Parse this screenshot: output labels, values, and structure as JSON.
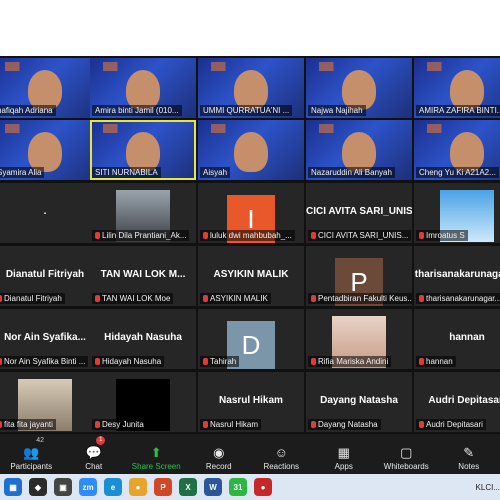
{
  "tiles": [
    {
      "name": "hafiqah-adriana",
      "label": "hafiqah Adriana",
      "kind": "video",
      "muted": false
    },
    {
      "name": "amira-binti-jamil",
      "label": "Amira binti Jamil (010...",
      "kind": "video",
      "muted": false
    },
    {
      "name": "ummi-qurratua",
      "label": "UMMI QURRATUA'NI ...",
      "kind": "video",
      "muted": false
    },
    {
      "name": "najwa-najihah",
      "label": "Najwa Najihah",
      "kind": "video",
      "muted": false
    },
    {
      "name": "amira-zafira",
      "label": "AMIRA ZAFIRA BINTI...",
      "kind": "video",
      "muted": false
    },
    {
      "name": "syamira-alia",
      "label": "Syamira Alia",
      "kind": "video",
      "muted": false
    },
    {
      "name": "siti-nurnabila",
      "label": "SITI NURNABILA",
      "kind": "video",
      "muted": false,
      "active": true
    },
    {
      "name": "aisyah",
      "label": "Aisyah",
      "kind": "video",
      "muted": false
    },
    {
      "name": "nazaruddin",
      "label": "Nazaruddin Ali Banyah",
      "kind": "video",
      "muted": false
    },
    {
      "name": "cheng-yu-ki",
      "label": "Cheng Yu Ki A21A2...",
      "kind": "video",
      "muted": false
    },
    {
      "name": "dot-user",
      "label": "",
      "center": ".",
      "kind": "empty",
      "muted": false
    },
    {
      "name": "lilin-dila",
      "label": "Lilin Dila Prantiani_Ak...",
      "kind": "photo",
      "muted": true
    },
    {
      "name": "luluk-dwi",
      "label": "luluk dwi mahbubah_...",
      "kind": "avatar",
      "letter": "I",
      "color": "#e8582a",
      "muted": true
    },
    {
      "name": "cici-avita",
      "label": "CICI AVITA SARI_UNIS...",
      "center": "CICI AVITA SARI_UNIS...",
      "kind": "name",
      "muted": true
    },
    {
      "name": "imroatus",
      "label": "Imroatus S",
      "kind": "sky",
      "muted": true
    },
    {
      "name": "dianatul-fitriyah",
      "label": "Dianatul Fitriyah",
      "center": "Dianatul Fitriyah",
      "kind": "name",
      "muted": true
    },
    {
      "name": "tan-wai-lok",
      "label": "TAN WAI LOK Moe",
      "center": "TAN WAI LOK M...",
      "kind": "name",
      "muted": true
    },
    {
      "name": "asyikin-malik",
      "label": "ASYIKIN MALIK",
      "center": "ASYIKIN MALIK",
      "kind": "name",
      "muted": true
    },
    {
      "name": "pentadbiran",
      "label": "Pentadbiran Fakulti Keus...",
      "kind": "avatar",
      "letter": "P",
      "color": "#6b4a3a",
      "muted": true
    },
    {
      "name": "tharisanakarunagaran",
      "label": "tharisanakarunagar...",
      "center": "tharisanakarunagaran",
      "kind": "name",
      "muted": true
    },
    {
      "name": "nor-ain-syafika",
      "label": "Nor Ain Syafika Binti ...",
      "center": "Nor Ain Syafika...",
      "kind": "name",
      "muted": true
    },
    {
      "name": "hidayah-nasuha",
      "label": "Hidayah Nasuha",
      "center": "Hidayah Nasuha",
      "kind": "name",
      "muted": true
    },
    {
      "name": "tahirah",
      "label": "Tahirah",
      "kind": "avatar",
      "letter": "D",
      "color": "#7b95a9",
      "muted": true
    },
    {
      "name": "rifia-mariska",
      "label": "Rifia Mariska Andini",
      "kind": "photo2",
      "muted": true
    },
    {
      "name": "hannan",
      "label": "hannan",
      "center": "hannan",
      "kind": "name",
      "muted": true
    },
    {
      "name": "fita-jayanti",
      "label": "fita fita jayanti",
      "kind": "photo3",
      "muted": true
    },
    {
      "name": "desy-junita",
      "label": "Desy Junita",
      "kind": "black",
      "muted": true
    },
    {
      "name": "nasrul-hikam",
      "label": "Nasrul Hikam",
      "center": "Nasrul Hikam",
      "kind": "name",
      "muted": true
    },
    {
      "name": "dayang-natasha",
      "label": "Dayang Natasha",
      "center": "Dayang Natasha",
      "kind": "name",
      "muted": true
    },
    {
      "name": "audri-depitasari",
      "label": "Audri Depitasari",
      "center": "Audri Depitasari",
      "kind": "name",
      "muted": true
    }
  ],
  "toolbar": {
    "participants": {
      "label": "Participants",
      "count": "42"
    },
    "chat": {
      "label": "Chat",
      "badge": "1"
    },
    "share": {
      "label": "Share Screen"
    },
    "record": {
      "label": "Record"
    },
    "reactions": {
      "label": "Reactions"
    },
    "apps": {
      "label": "Apps"
    },
    "whiteboards": {
      "label": "Whiteboards"
    },
    "notes": {
      "label": "Notes"
    }
  },
  "taskbar": {
    "zoom_badge": "zm",
    "whatsapp_count": "31",
    "klci_label": "KLCI..."
  },
  "colors": {
    "accent_green": "#29c34a",
    "muted_red": "#e03b3b",
    "active_border": "#e6e63a"
  }
}
